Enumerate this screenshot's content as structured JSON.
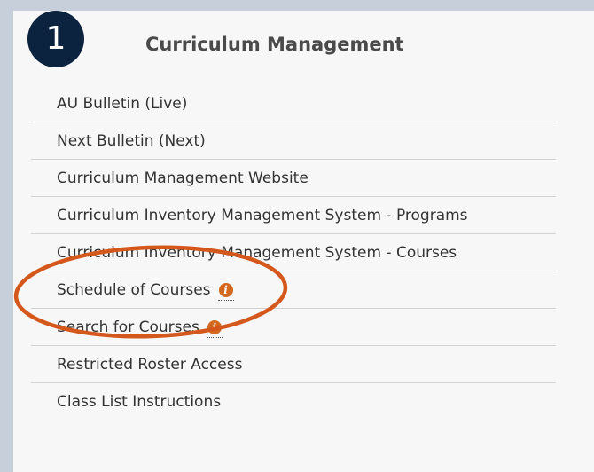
{
  "step": {
    "number": "1",
    "color": "#0c2340"
  },
  "heading": "Curriculum Management",
  "links": [
    {
      "label": "AU Bulletin (Live)",
      "info": false
    },
    {
      "label": "Next Bulletin (Next)",
      "info": false
    },
    {
      "label": "Curriculum Management Website",
      "info": false
    },
    {
      "label": "Curriculum Inventory Management System - Programs",
      "info": false
    },
    {
      "label": "Curriculum Inventory Management System - Courses",
      "info": false
    },
    {
      "label": "Schedule of Courses",
      "info": true
    },
    {
      "label": "Search for Courses",
      "info": true
    },
    {
      "label": "Restricted Roster Access",
      "info": false
    },
    {
      "label": "Class List Instructions",
      "info": false
    }
  ],
  "info_icon": {
    "glyph": "i",
    "color": "#d2691e",
    "icon": "info-circle-icon"
  },
  "highlight": {
    "color": "#d4581c",
    "targets": [
      "Schedule of Courses",
      "Search for Courses"
    ]
  },
  "colors": {
    "background": "#c7d0da",
    "panel": "#f7f7f7",
    "divider": "#d2d2d2",
    "text": "#333333",
    "heading": "#4a4a4a"
  }
}
